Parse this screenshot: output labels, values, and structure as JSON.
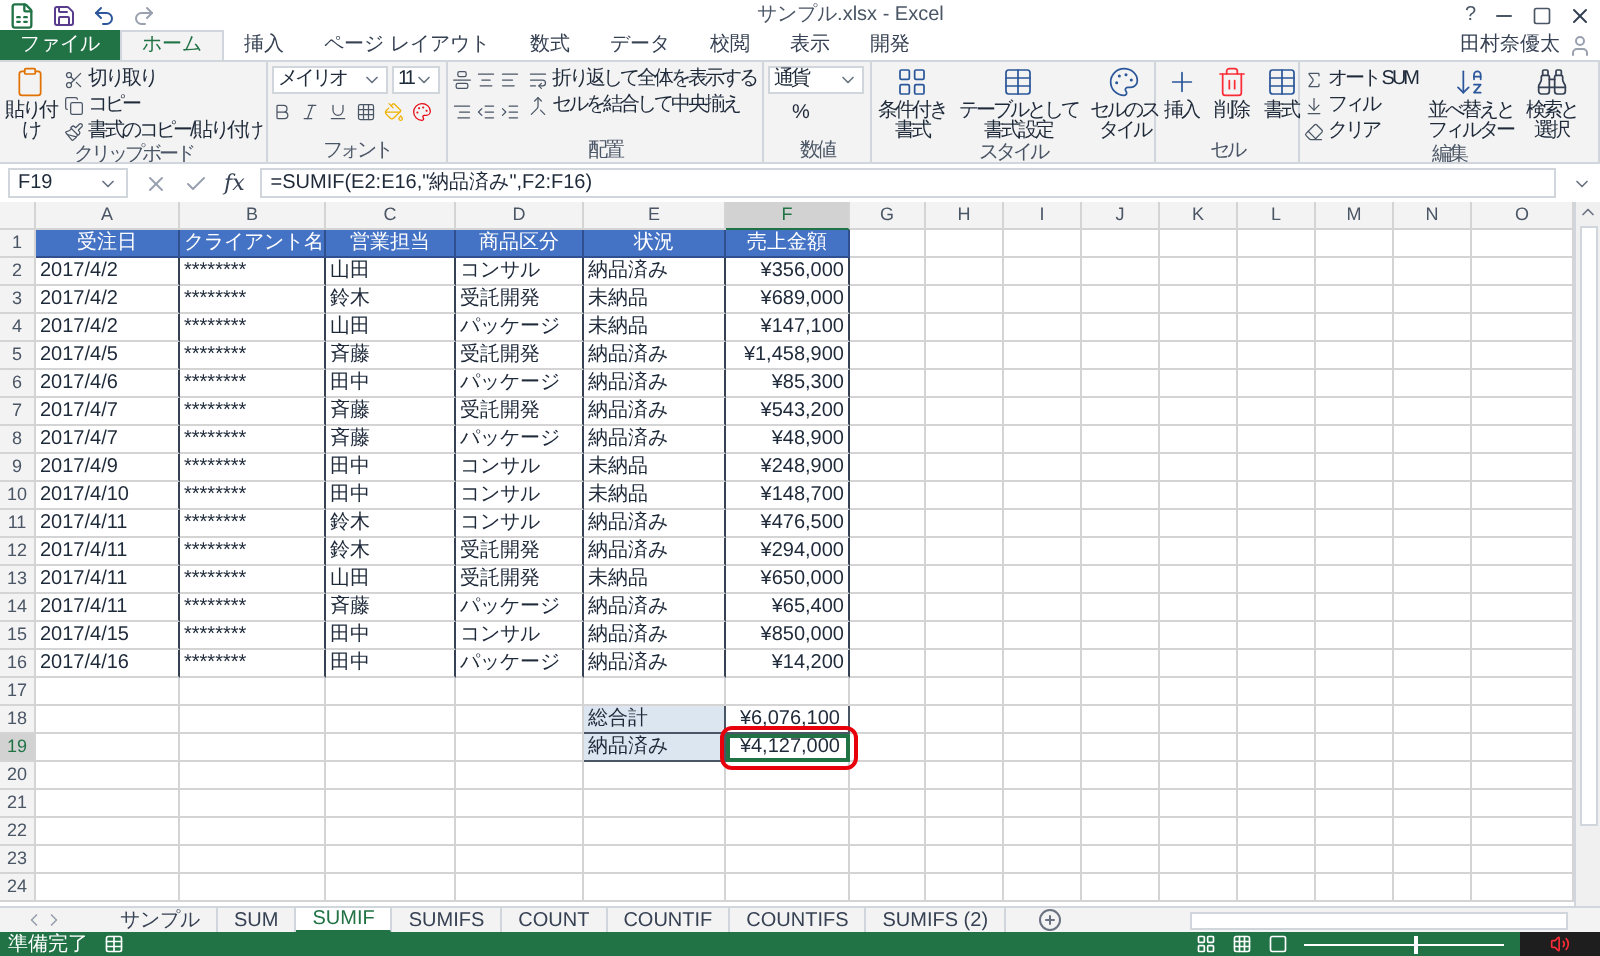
{
  "window": {
    "title": "サンプル.xlsx - Excel",
    "help": "?",
    "user": "田村奈優太"
  },
  "ribbon_tabs": [
    {
      "label": "ファイル",
      "kind": "file",
      "selected": false
    },
    {
      "label": "ホーム",
      "kind": "tab",
      "selected": true
    },
    {
      "label": "挿入",
      "kind": "tab",
      "selected": false
    },
    {
      "label": "ページ レイアウト",
      "kind": "tab",
      "selected": false
    },
    {
      "label": "数式",
      "kind": "tab",
      "selected": false
    },
    {
      "label": "データ",
      "kind": "tab",
      "selected": false
    },
    {
      "label": "校閲",
      "kind": "tab",
      "selected": false
    },
    {
      "label": "表示",
      "kind": "tab",
      "selected": false
    },
    {
      "label": "開発",
      "kind": "tab",
      "selected": false
    }
  ],
  "ribbon": {
    "clipboard": {
      "label": "クリップボード",
      "paste": "貼り付け",
      "cut": "切り取り",
      "copy": "コピー",
      "format_painter": "書式のコピー/貼り付け"
    },
    "font": {
      "label": "フォント",
      "name": "メイリオ",
      "size": "11"
    },
    "alignment": {
      "label": "配置",
      "wrap": "折り返して全体を表示する",
      "merge": "セルを結合して中央揃え"
    },
    "number": {
      "label": "数値",
      "format": "通貨",
      "percent": "%"
    },
    "styles": {
      "label": "スタイル",
      "items": [
        "条件付き書式",
        "テーブルとして書式設定",
        "セルのスタイル"
      ]
    },
    "cells": {
      "label": "セル",
      "items": [
        "挿入",
        "削除",
        "書式"
      ]
    },
    "editing": {
      "label": "編集",
      "autosum": "オート SUM",
      "fill": "フィル",
      "clear": "クリア",
      "sort": "並べ替えとフィルター",
      "find": "検索と選択"
    }
  },
  "formula_bar": {
    "name_box": "F19",
    "fx": "fx",
    "formula": "=SUMIF(E2:E16,\"納品済み\",F2:F16)"
  },
  "columns": [
    {
      "label": "A",
      "selected": false
    },
    {
      "label": "B",
      "selected": false
    },
    {
      "label": "C",
      "selected": false
    },
    {
      "label": "D",
      "selected": false
    },
    {
      "label": "E",
      "selected": false
    },
    {
      "label": "F",
      "selected": true
    },
    {
      "label": "G",
      "selected": false
    },
    {
      "label": "H",
      "selected": false
    },
    {
      "label": "I",
      "selected": false
    },
    {
      "label": "J",
      "selected": false
    },
    {
      "label": "K",
      "selected": false
    },
    {
      "label": "L",
      "selected": false
    },
    {
      "label": "M",
      "selected": false
    },
    {
      "label": "N",
      "selected": false
    },
    {
      "label": "O",
      "selected": false
    }
  ],
  "rows": [
    {
      "number": "1",
      "kind": "header",
      "selected": false,
      "cells": [
        "受注日",
        "クライアント名",
        "営業担当",
        "商品区分",
        "状況",
        "売上金額"
      ]
    },
    {
      "number": "2",
      "kind": "data",
      "selected": false,
      "cells": [
        "2017/4/2",
        "********",
        "山田",
        "コンサル",
        "納品済み",
        "¥356,000"
      ]
    },
    {
      "number": "3",
      "kind": "data",
      "selected": false,
      "cells": [
        "2017/4/2",
        "********",
        "鈴木",
        "受託開発",
        "未納品",
        "¥689,000"
      ]
    },
    {
      "number": "4",
      "kind": "data",
      "selected": false,
      "cells": [
        "2017/4/2",
        "********",
        "山田",
        "パッケージ",
        "未納品",
        "¥147,100"
      ]
    },
    {
      "number": "5",
      "kind": "data",
      "selected": false,
      "cells": [
        "2017/4/5",
        "********",
        "斉藤",
        "受託開発",
        "納品済み",
        "¥1,458,900"
      ]
    },
    {
      "number": "6",
      "kind": "data",
      "selected": false,
      "cells": [
        "2017/4/6",
        "********",
        "田中",
        "パッケージ",
        "納品済み",
        "¥85,300"
      ]
    },
    {
      "number": "7",
      "kind": "data",
      "selected": false,
      "cells": [
        "2017/4/7",
        "********",
        "斉藤",
        "受託開発",
        "納品済み",
        "¥543,200"
      ]
    },
    {
      "number": "8",
      "kind": "data",
      "selected": false,
      "cells": [
        "2017/4/7",
        "********",
        "斉藤",
        "パッケージ",
        "納品済み",
        "¥48,900"
      ]
    },
    {
      "number": "9",
      "kind": "data",
      "selected": false,
      "cells": [
        "2017/4/9",
        "********",
        "田中",
        "コンサル",
        "未納品",
        "¥248,900"
      ]
    },
    {
      "number": "10",
      "kind": "data",
      "selected": false,
      "cells": [
        "2017/4/10",
        "********",
        "田中",
        "コンサル",
        "未納品",
        "¥148,700"
      ]
    },
    {
      "number": "11",
      "kind": "data",
      "selected": false,
      "cells": [
        "2017/4/11",
        "********",
        "鈴木",
        "コンサル",
        "納品済み",
        "¥476,500"
      ]
    },
    {
      "number": "12",
      "kind": "data",
      "selected": false,
      "cells": [
        "2017/4/11",
        "********",
        "鈴木",
        "受託開発",
        "納品済み",
        "¥294,000"
      ]
    },
    {
      "number": "13",
      "kind": "data",
      "selected": false,
      "cells": [
        "2017/4/11",
        "********",
        "山田",
        "受託開発",
        "未納品",
        "¥650,000"
      ]
    },
    {
      "number": "14",
      "kind": "data",
      "selected": false,
      "cells": [
        "2017/4/11",
        "********",
        "斉藤",
        "パッケージ",
        "納品済み",
        "¥65,400"
      ]
    },
    {
      "number": "15",
      "kind": "data",
      "selected": false,
      "cells": [
        "2017/4/15",
        "********",
        "田中",
        "コンサル",
        "納品済み",
        "¥850,000"
      ]
    },
    {
      "number": "16",
      "kind": "data",
      "selected": false,
      "cells": [
        "2017/4/16",
        "********",
        "田中",
        "パッケージ",
        "納品済み",
        "¥14,200"
      ]
    },
    {
      "number": "17",
      "kind": "empty",
      "selected": false
    },
    {
      "number": "18",
      "kind": "summary",
      "selected": false,
      "circled": false,
      "cells": [
        "総合計",
        "¥6,076,100"
      ]
    },
    {
      "number": "19",
      "kind": "summary",
      "selected": true,
      "circled": true,
      "cells": [
        "納品済み",
        "¥4,127,000"
      ]
    },
    {
      "number": "20",
      "kind": "empty",
      "selected": false
    },
    {
      "number": "21",
      "kind": "empty",
      "selected": false
    },
    {
      "number": "22",
      "kind": "empty",
      "selected": false
    },
    {
      "number": "23",
      "kind": "empty",
      "selected": false
    },
    {
      "number": "24",
      "kind": "empty",
      "selected": false
    }
  ],
  "sheet_tabs": [
    {
      "label": "サンプル",
      "selected": false
    },
    {
      "label": "SUM",
      "selected": false
    },
    {
      "label": "SUMIF",
      "selected": true
    },
    {
      "label": "SUMIFS",
      "selected": false
    },
    {
      "label": "COUNT",
      "selected": false
    },
    {
      "label": "COUNTIF",
      "selected": false
    },
    {
      "label": "COUNTIFS",
      "selected": false
    },
    {
      "label": "SUMIFS (2)",
      "selected": false
    }
  ],
  "status_bar": {
    "text": "準備完了",
    "zoom": {
      "level": 0.55
    }
  }
}
